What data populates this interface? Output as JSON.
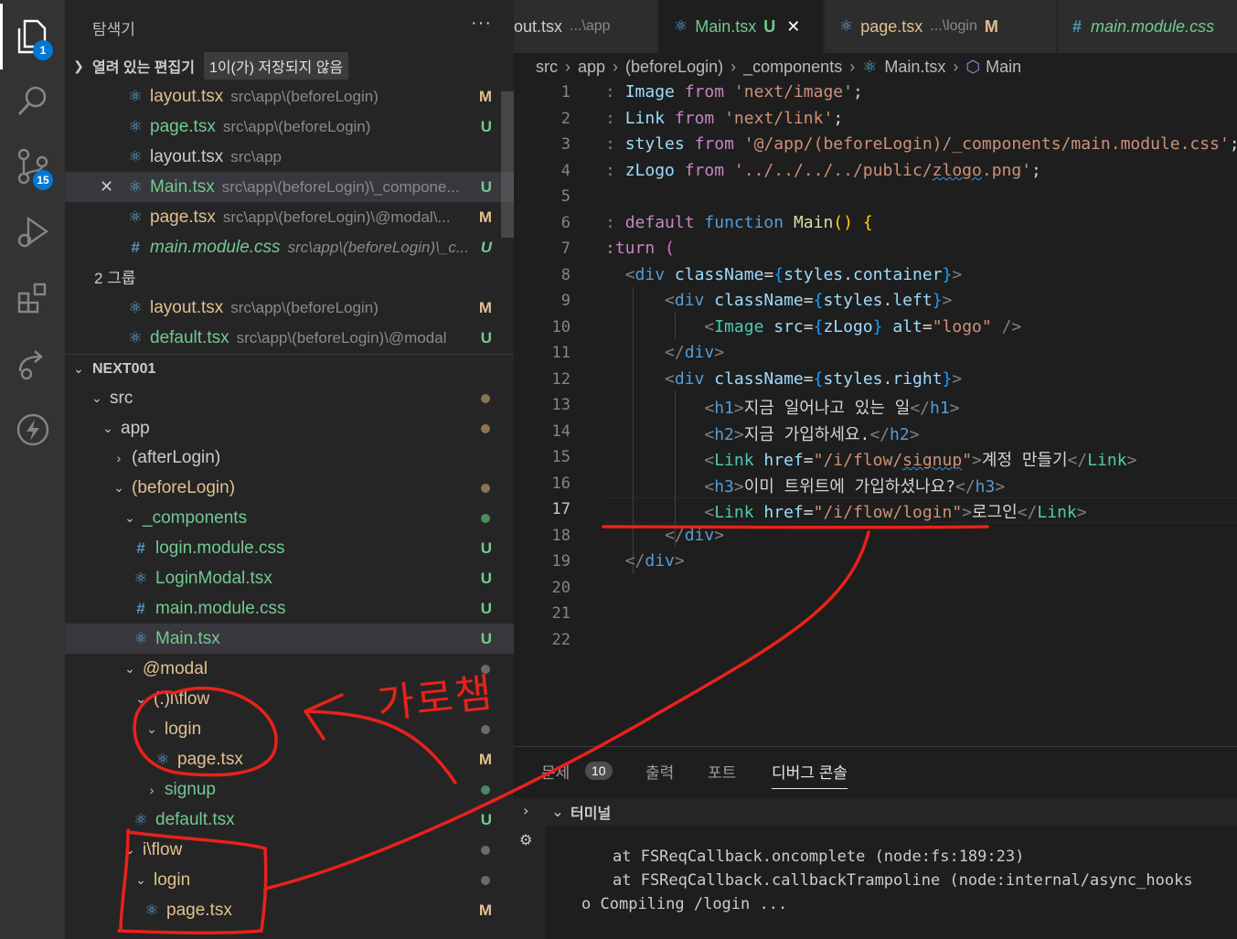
{
  "activity": {
    "explorer_badge": "1",
    "scm_badge": "15"
  },
  "sidebar": {
    "title": "탐색기",
    "more": "···",
    "open_editors": {
      "label": "열려 있는 편집기",
      "unsaved_badge": "1이(가) 저장되지 않음",
      "items": [
        {
          "name": "layout.tsx",
          "path": "src\\app\\(beforeLogin)",
          "status": "M"
        },
        {
          "name": "page.tsx",
          "path": "src\\app\\(beforeLogin)",
          "status": "U"
        },
        {
          "name": "layout.tsx",
          "path": "src\\app",
          "status": ""
        },
        {
          "name": "Main.tsx",
          "path": "src\\app\\(beforeLogin)\\_compone...",
          "status": "U"
        },
        {
          "name": "page.tsx",
          "path": "src\\app\\(beforeLogin)\\@modal\\...",
          "status": "M"
        },
        {
          "name": "main.module.css",
          "path": "src\\app\\(beforeLogin)\\_c...",
          "status": "U"
        }
      ],
      "group2_label": "2 그룹",
      "group2_items": [
        {
          "name": "layout.tsx",
          "path": "src\\app\\(beforeLogin)",
          "status": "M"
        },
        {
          "name": "default.tsx",
          "path": "src\\app\\(beforeLogin)\\@modal",
          "status": "U"
        }
      ]
    },
    "project": {
      "label": "NEXT001",
      "tree": [
        {
          "name": "src",
          "status": ""
        },
        {
          "name": "app",
          "status": ""
        },
        {
          "name": "(afterLogin)",
          "status": ""
        },
        {
          "name": "(beforeLogin)",
          "status": ""
        },
        {
          "name": "_components",
          "status": ""
        },
        {
          "name": "login.module.css",
          "status": "U"
        },
        {
          "name": "LoginModal.tsx",
          "status": "U"
        },
        {
          "name": "main.module.css",
          "status": "U"
        },
        {
          "name": "Main.tsx",
          "status": "U"
        },
        {
          "name": "@modal",
          "status": ""
        },
        {
          "name": "(.)i\\flow",
          "status": ""
        },
        {
          "name": "login",
          "status": ""
        },
        {
          "name": "page.tsx",
          "status": "M"
        },
        {
          "name": "signup",
          "status": ""
        },
        {
          "name": "default.tsx",
          "status": "U"
        },
        {
          "name": "i\\flow",
          "status": ""
        },
        {
          "name": "login",
          "status": ""
        },
        {
          "name": "page.tsx",
          "status": "M"
        }
      ]
    }
  },
  "tabs": [
    {
      "name": "out.tsx",
      "path": "...\\app",
      "status": ""
    },
    {
      "name": "Main.tsx",
      "path": "",
      "status": "U",
      "close": "✕"
    },
    {
      "name": "page.tsx",
      "path": "...\\login",
      "status": "M"
    },
    {
      "name": "main.module.css",
      "path": "",
      "status": ""
    }
  ],
  "breadcrumb": {
    "parts": [
      "src",
      "app",
      "(beforeLogin)",
      "_components",
      "Main.tsx",
      "Main"
    ]
  },
  "editor": {
    "line_numbers": [
      "1",
      "2",
      "3",
      "4",
      "5",
      "6",
      "7",
      "8",
      "9",
      "10",
      "11",
      "12",
      "13",
      "14",
      "15",
      "16",
      "17",
      "18",
      "19",
      "20",
      "21",
      "22"
    ],
    "current_line": "17",
    "lines": [
      ": Image from 'next/image';",
      ": Link from 'next/link';",
      ": styles from '@/app/(beforeLogin)/_components/main.module.css';",
      ": zLogo from '../../../../public/zlogo.png';",
      "",
      ": default function Main() {",
      ":turn (",
      "<div className={styles.container}>",
      "<div className={styles.left}>",
      "<Image src={zLogo} alt=\"logo\" />",
      "</div>",
      "<div className={styles.right}>",
      "<h1>지금 일어나고 있는 일</h1>",
      "<h2>지금 가입하세요.</h2>",
      "<Link href=\"/i/flow/signup\">계정 만들기</Link>",
      "<h3>이미 트위트에 가입하셨나요?</h3>",
      "<Link href=\"/i/flow/login\">로그인</Link>",
      "</div>",
      "</div>"
    ]
  },
  "panel": {
    "tabs": [
      "문제",
      "출력",
      "포트",
      "디버그 콘솔"
    ],
    "problems_count": "10",
    "terminal_label": "터미널",
    "terminal_lines": [
      "at FSReqCallback.oncomplete (node:fs:189:23)",
      "at FSReqCallback.callbackTrampoline (node:internal/async_hooks",
      "Compiling /login ..."
    ],
    "terminal_prompt": "o"
  },
  "annotation": {
    "text": "가로챔",
    "color": "#e8221a"
  }
}
